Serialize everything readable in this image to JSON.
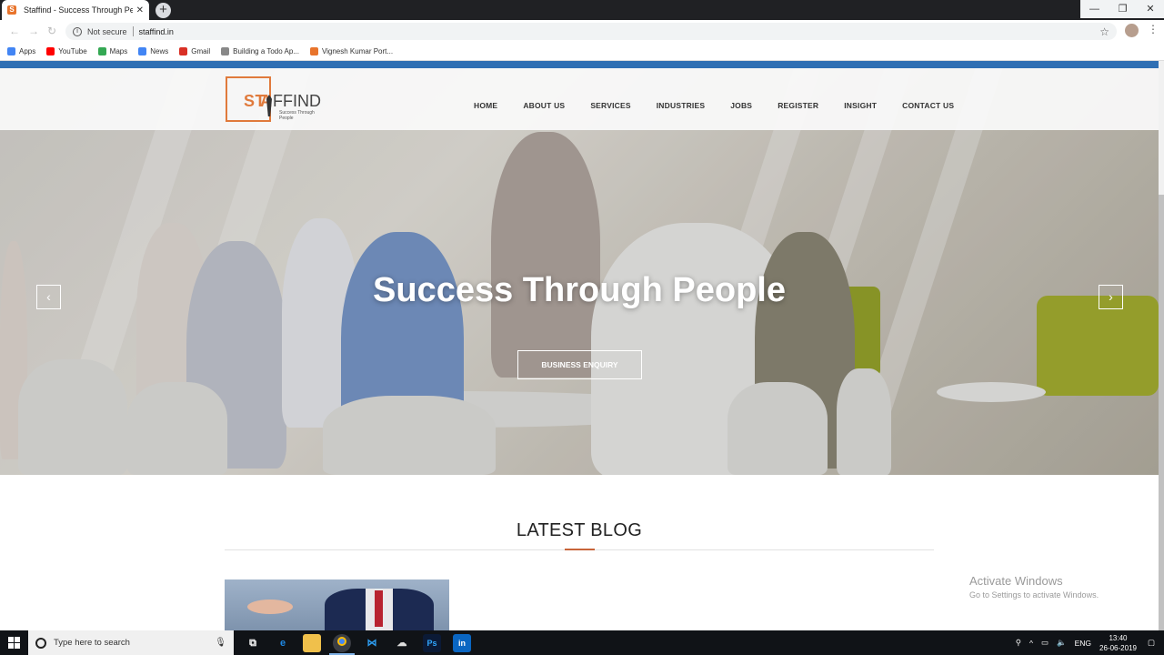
{
  "browser": {
    "tab_title": "Staffind - Success Through Peopl",
    "tab_close": "✕",
    "new_tab": "+",
    "security_label": "Not secure",
    "url": "staffind.in",
    "bookmarks": [
      {
        "label": "Apps",
        "color": "#4285f4"
      },
      {
        "label": "YouTube",
        "color": "#ff0000"
      },
      {
        "label": "Maps",
        "color": "#34a853"
      },
      {
        "label": "News",
        "color": "#4285f4"
      },
      {
        "label": "Gmail",
        "color": "#d93025"
      },
      {
        "label": "Building a Todo Ap...",
        "color": "#888888"
      },
      {
        "label": "Vignesh Kumar Port...",
        "color": "#e8742c"
      }
    ]
  },
  "site": {
    "brand_colors": {
      "accent": "#e07a3c",
      "blue_bar": "#2f6fb3"
    },
    "logo": {
      "st": "ST",
      "a": "A",
      "find": "FFIND",
      "tagline": "Success Through People"
    },
    "nav": [
      "HOME",
      "ABOUT US",
      "SERVICES",
      "INDUSTRIES",
      "JOBS",
      "REGISTER",
      "INSIGHT",
      "CONTACT US"
    ],
    "hero": {
      "headline": "Success Through People",
      "cta": "BUSINESS ENQUIRY",
      "prev": "‹",
      "next": "›"
    },
    "blog": {
      "title": "LATEST BLOG"
    }
  },
  "watermark": {
    "line1": "Activate Windows",
    "line2": "Go to Settings to activate Windows."
  },
  "taskbar": {
    "search_placeholder": "Type here to search",
    "language": "ENG",
    "time": "13:40",
    "date": "26-06-2019"
  }
}
